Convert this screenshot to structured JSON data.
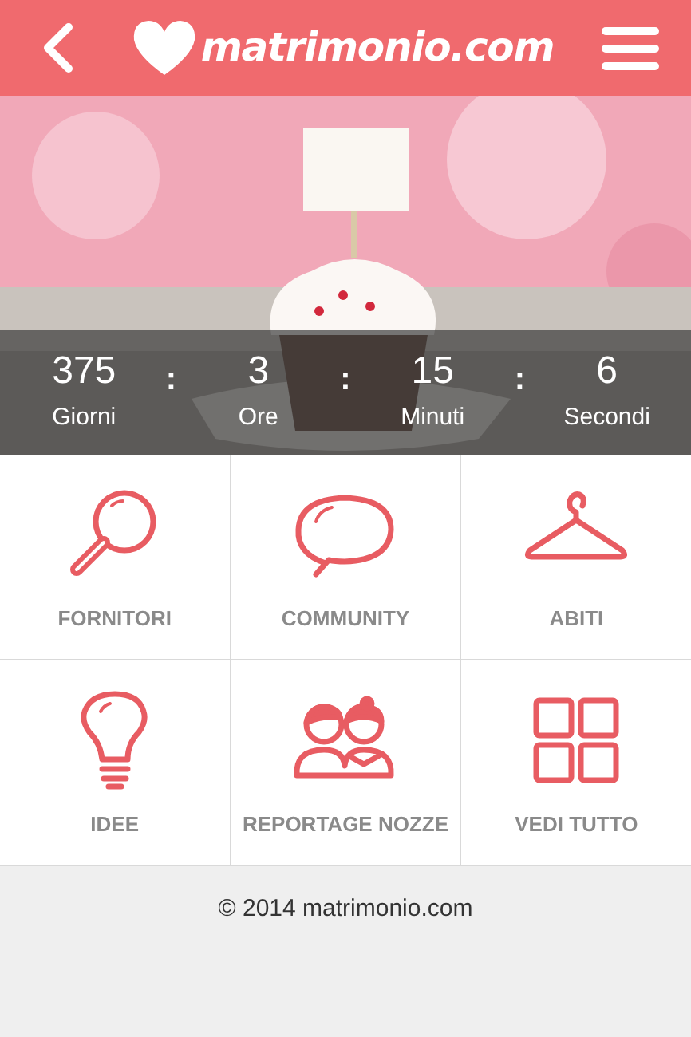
{
  "header": {
    "logo_text": "matrimonio.com"
  },
  "countdown": [
    {
      "value": "375",
      "unit": "Giorni"
    },
    {
      "value": "3",
      "unit": "Ore"
    },
    {
      "value": "15",
      "unit": "Minuti"
    },
    {
      "value": "6",
      "unit": "Secondi"
    }
  ],
  "separator": ":",
  "menu": [
    {
      "label": "FORNITORI",
      "kind": "search"
    },
    {
      "label": "COMMUNITY",
      "kind": "chat"
    },
    {
      "label": "ABITI",
      "kind": "hanger"
    },
    {
      "label": "IDEE",
      "kind": "bulb"
    },
    {
      "label": "REPORTAGE NOZZE",
      "kind": "couple"
    },
    {
      "label": "VEDI TUTTO",
      "kind": "grid"
    }
  ],
  "footer": "© 2014 matrimonio.com"
}
